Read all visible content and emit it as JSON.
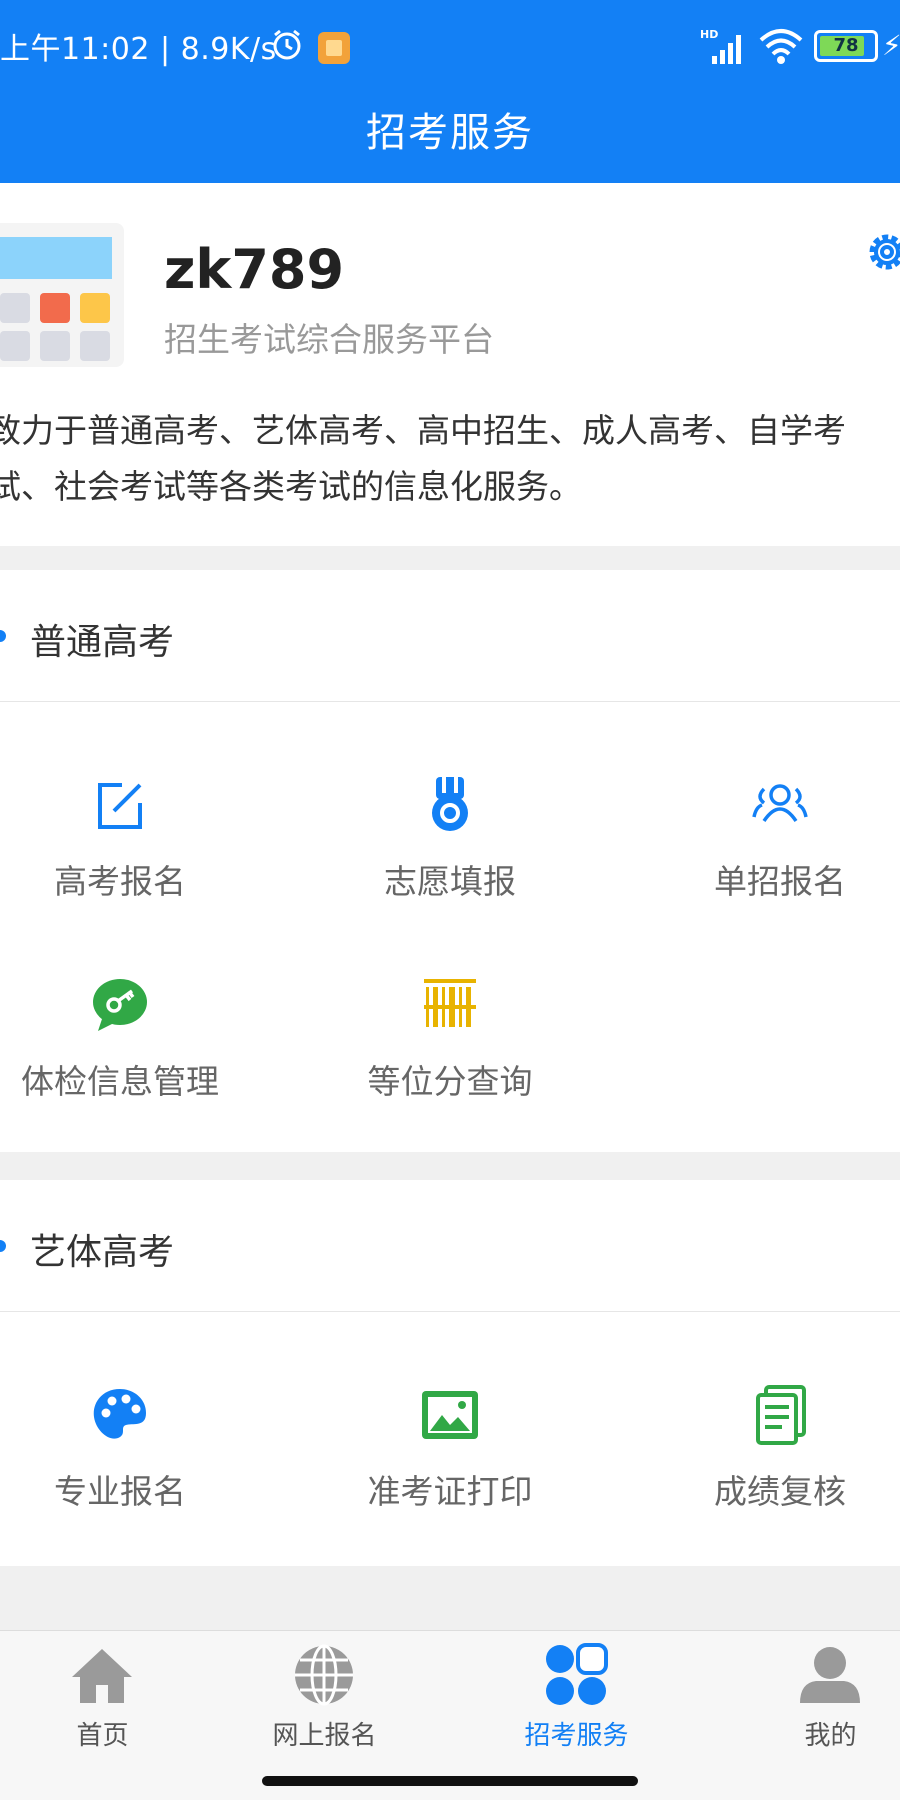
{
  "status": {
    "time_text": "上午11:02 | 8.9K/s",
    "signal": "HD",
    "battery": "78"
  },
  "header": {
    "title": "招考服务"
  },
  "intro": {
    "app_name": "zk789",
    "app_subtitle": "招生考试综合服务平台",
    "desc_line1": "致力于普通高考、艺体高考、高中招生、成人高考、自学考",
    "desc_line2": "试、社会考试等各类考试的信息化服务。"
  },
  "sections": [
    {
      "title": "普通高考",
      "items": [
        {
          "label": "高考报名",
          "icon": "edit-icon"
        },
        {
          "label": "志愿填报",
          "icon": "medal-icon"
        },
        {
          "label": "单招报名",
          "icon": "group-icon"
        },
        {
          "label": "体检信息管理",
          "icon": "key-chat-icon"
        },
        {
          "label": "等位分查询",
          "icon": "barcode-icon"
        }
      ]
    },
    {
      "title": "艺体高考",
      "items": [
        {
          "label": "专业报名",
          "icon": "palette-icon"
        },
        {
          "label": "准考证打印",
          "icon": "image-icon"
        },
        {
          "label": "成绩复核",
          "icon": "document-icon"
        }
      ]
    }
  ],
  "bottom_nav": [
    {
      "label": "首页",
      "icon": "home-icon",
      "active": false
    },
    {
      "label": "网上报名",
      "icon": "globe-icon",
      "active": false
    },
    {
      "label": "招考服务",
      "icon": "grid-icon",
      "active": true
    },
    {
      "label": "我的",
      "icon": "person-icon",
      "active": false
    }
  ],
  "colors": {
    "primary": "#1380f5",
    "green": "#31a846",
    "yellow": "#e8b300"
  }
}
